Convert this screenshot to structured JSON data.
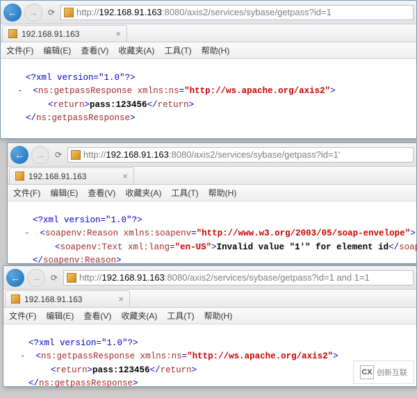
{
  "windowA": {
    "url_prefix": "http://",
    "url_ip": "192.168.91.163",
    "url_rest": ":8080/axis2/services/sybase/getpass?id=1",
    "tab_label": "192.168.91.163",
    "menu": {
      "file": "文件(F)",
      "edit": "编辑(E)",
      "view": "查看(V)",
      "fav": "收藏夹(A)",
      "tools": "工具(T)",
      "help": "帮助(H)"
    },
    "xml": {
      "decl_open": "<?",
      "decl_name": "xml version",
      "decl_eq": "=",
      "decl_ver": "\"1.0\"",
      "decl_close": "?>",
      "lt": "<",
      "gt": ">",
      "close_lt": "</",
      "slash_gt": "/>",
      "resp_tag": "ns:getpassResponse",
      "xmlns_attr": "xmlns:ns",
      "eq": "=",
      "xmlns_val": "\"http://ws.apache.org/axis2\"",
      "return_tag": "return",
      "return_text": "pass:123456",
      "dash": "-"
    }
  },
  "windowB": {
    "url_prefix": "http://",
    "url_ip": "192.168.91.163",
    "url_rest": ":8080/axis2/services/sybase/getpass?id=1'",
    "tab_label": "192.168.91.163",
    "menu": {
      "file": "文件(F)",
      "edit": "编辑(E)",
      "view": "查看(V)",
      "fav": "收藏夹(A)",
      "tools": "工具(T)",
      "help": "帮助(H)"
    },
    "xml": {
      "decl_open": "<?",
      "decl_name": "xml version",
      "decl_eq": "=",
      "decl_ver": "\"1.0\"",
      "decl_close": "?>",
      "lt": "<",
      "gt": ">",
      "close_lt": "</",
      "reason_tag": "soapenv:Reason",
      "xmlns_attr": "xmlns:soapenv",
      "eq": "=",
      "xmlns_val": "\"http://www.w3.org/2003/05/soap-envelope\"",
      "text_tag": "soapenv:Text",
      "lang_attr": "xml:lang",
      "lang_val": "\"en-US\"",
      "body_text": "Invalid value \"1'\" for element id",
      "dash": "-"
    }
  },
  "windowC": {
    "url_prefix": "http://",
    "url_ip": "192.168.91.163",
    "url_rest": ":8080/axis2/services/sybase/getpass?id=1 and 1=1",
    "tab_label": "192.168.91.163",
    "menu": {
      "file": "文件(F)",
      "edit": "编辑(E)",
      "view": "查看(V)",
      "fav": "收藏夹(A)",
      "tools": "工具(T)",
      "help": "帮助(H)"
    },
    "xml": {
      "decl_open": "<?",
      "decl_name": "xml version",
      "decl_eq": "=",
      "decl_ver": "\"1.0\"",
      "decl_close": "?>",
      "lt": "<",
      "gt": ">",
      "close_lt": "</",
      "resp_tag": "ns:getpassResponse",
      "xmlns_attr": "xmlns:ns",
      "eq": "=",
      "xmlns_val": "\"http://ws.apache.org/axis2\"",
      "return_tag": "return",
      "return_text": "pass:123456",
      "dash": "-"
    }
  },
  "watermark": "创新互联"
}
